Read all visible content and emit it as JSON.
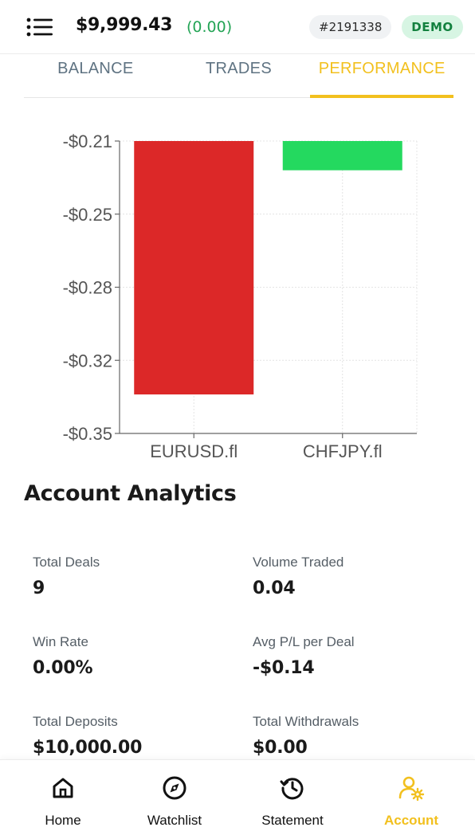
{
  "header": {
    "balance": "$9,999.43",
    "balance_change": "(0.00)",
    "account_number": "#2191338",
    "account_type": "DEMO"
  },
  "tabs": [
    {
      "label": "BALANCE",
      "active": false
    },
    {
      "label": "TRADES",
      "active": false
    },
    {
      "label": "PERFORMANCE",
      "active": true
    }
  ],
  "chart_data": {
    "type": "bar",
    "categories": [
      "EURUSD.fl",
      "CHFJPY.fl"
    ],
    "values": [
      -0.34,
      -0.225
    ],
    "colors": [
      "#dc2828",
      "#24d95f"
    ],
    "ylim": [
      -0.35,
      -0.21
    ],
    "yticks": [
      "-$0.21",
      "-$0.25",
      "-$0.28",
      "-$0.32",
      "-$0.35"
    ],
    "ytick_values": [
      -0.21,
      -0.2475,
      -0.285,
      -0.3225,
      -0.36
    ],
    "grid": true
  },
  "analytics": {
    "title": "Account Analytics",
    "stats": [
      {
        "label": "Total Deals",
        "value": "9"
      },
      {
        "label": "Volume Traded",
        "value": "0.04"
      },
      {
        "label": "Win Rate",
        "value": "0.00%"
      },
      {
        "label": "Avg P/L per Deal",
        "value": "-$0.14"
      },
      {
        "label": "Total Deposits",
        "value": "$10,000.00"
      },
      {
        "label": "Total Withdrawals",
        "value": "$0.00"
      }
    ]
  },
  "nav": [
    {
      "label": "Home",
      "icon": "home-icon",
      "active": false
    },
    {
      "label": "Watchlist",
      "icon": "compass-icon",
      "active": false
    },
    {
      "label": "Statement",
      "icon": "history-icon",
      "active": false
    },
    {
      "label": "Account",
      "icon": "user-settings-icon",
      "active": true
    }
  ],
  "colors": {
    "accent": "#f2c01e",
    "positive": "#23a455",
    "loss_bar": "#dc2828",
    "gain_bar": "#24d95f"
  }
}
